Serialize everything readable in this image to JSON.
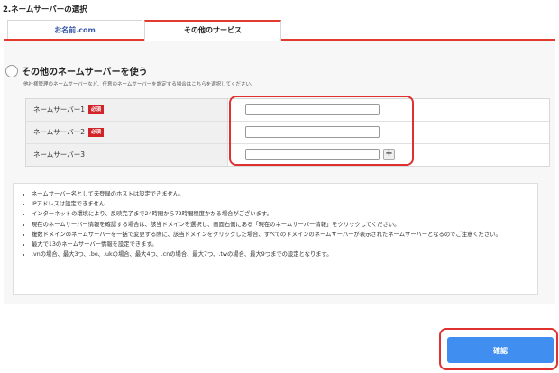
{
  "section": {
    "title": "2.ネームサーバーの選択"
  },
  "tabs": [
    {
      "label": "お名前.com"
    },
    {
      "label": "その他のサービス"
    }
  ],
  "option": {
    "title": "その他のネームサーバーを使う",
    "description": "他社様管理のネームサーバーなど、任意のネームサーバーを設定する場合はこちらを選択してください。"
  },
  "nameservers": [
    {
      "label": "ネームサーバー1",
      "required": "必須",
      "value": ""
    },
    {
      "label": "ネームサーバー2",
      "required": "必須",
      "value": ""
    },
    {
      "label": "ネームサーバー3",
      "value": ""
    }
  ],
  "add_button_symbol": "+",
  "notes": [
    "ネームサーバー名として未登録のホストは設定できません。",
    "IPアドレスは設定できません",
    "インターネットの環境により、反映完了まで24時間から72時間程度かかる場合がございます。",
    "現在のネームサーバー情報を確認する場合は、該当ドメインを選択し、画面右側にある「現在のネームサーバー情報」をクリックしてください。",
    "複数ドメインのネームサーバーを一括で変更する際に、該当ドメインをクリックした場合、すべてのドメインのネームサーバーが表示されたネームサーバーとなるのでご注意ください。",
    "最大で13のネームサーバー情報を設定できます。",
    ".vnの場合、最大3つ、.be、.ukの場合、最大4つ、.cnの場合、最大7つ、.twの場合、最大9つまでの設定となります。"
  ],
  "confirm_button": "確認",
  "colors": {
    "accent_red": "#e23a2f",
    "confirm_blue": "#3f8ef0",
    "tab_link": "#3b5aa8"
  }
}
